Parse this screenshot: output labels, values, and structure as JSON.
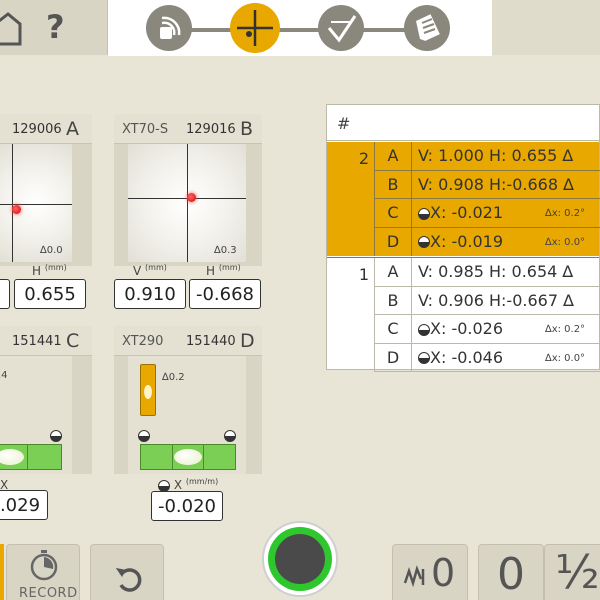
{
  "header": {
    "help_glyph": "?",
    "steps": [
      {
        "icon": "signal-icon"
      },
      {
        "icon": "crosshair-icon",
        "active": true
      },
      {
        "icon": "check-level-icon"
      },
      {
        "icon": "document-icon"
      }
    ]
  },
  "panels": {
    "A": {
      "serial": "129006",
      "letter": "A",
      "tilt": "0.0",
      "h_label": "H",
      "unit": "(mm)",
      "h_value": "0.655"
    },
    "B": {
      "name": "XT70-S",
      "serial": "129016",
      "letter": "B",
      "tilt": "0.3",
      "v_label": "V",
      "h_label": "H",
      "unit": "(mm)",
      "v_value": "0.910",
      "h_value": "-0.668"
    },
    "C": {
      "serial": "151441",
      "letter": "C",
      "tilt": ".4",
      "x_value": ".029"
    },
    "D": {
      "name": "XT290",
      "serial": "151440",
      "letter": "D",
      "tilt": "0.2",
      "x_label": "X",
      "unit": "(mm/m)",
      "x_value": "-0.020"
    }
  },
  "table": {
    "header": "#",
    "groups": [
      {
        "num": "2",
        "highlight": true,
        "rows": [
          {
            "label": "A",
            "text": "V: 1.000  H: 0.655",
            "tail": "∆"
          },
          {
            "label": "B",
            "text": "V: 0.908  H:-0.668",
            "tail": "∆"
          },
          {
            "label": "C",
            "text": "X: -0.021",
            "sub": "∆x:    0.2°"
          },
          {
            "label": "D",
            "text": "X: -0.019",
            "sub": "∆x:    0.0°"
          }
        ]
      },
      {
        "num": "1",
        "highlight": false,
        "rows": [
          {
            "label": "A",
            "text": "V: 0.985  H: 0.654",
            "tail": "∆"
          },
          {
            "label": "B",
            "text": "V: 0.906  H:-0.667",
            "tail": "∆"
          },
          {
            "label": "C",
            "text": "X: -0.026",
            "sub": "∆x:    0.2°"
          },
          {
            "label": "D",
            "text": "X: -0.046",
            "sub": "∆x:    0.0°"
          }
        ]
      }
    ]
  },
  "bottom": {
    "record_label": "RECORD",
    "counter_value": "0",
    "zero_label": "0",
    "half_label": "½"
  },
  "colors": {
    "accent": "#e8a800",
    "level_green": "#7ccf55",
    "laser_red": "#d90000",
    "shutter_green": "#2ec82e"
  }
}
